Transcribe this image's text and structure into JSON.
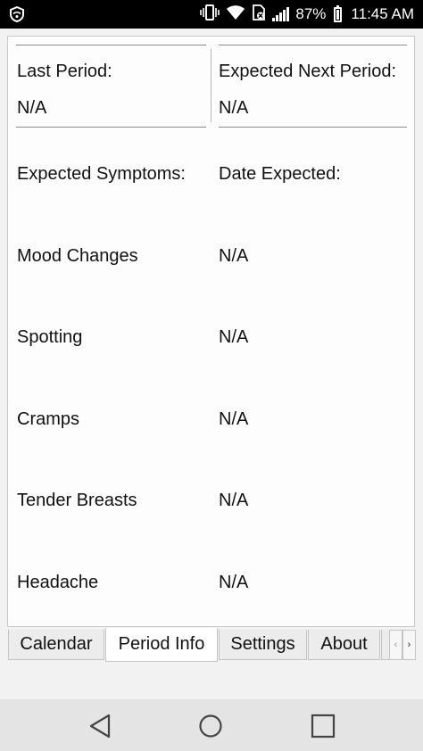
{
  "status_bar": {
    "battery_percent": "87%",
    "time": "11:45 AM",
    "icons": [
      "vpn-shield-icon",
      "vibrate-icon",
      "wifi-icon",
      "no-sim-icon",
      "signal-icon",
      "battery-icon"
    ]
  },
  "period": {
    "last_label": "Last Period:",
    "last_value": "N/A",
    "next_label": "Expected Next Period:",
    "next_value": "N/A"
  },
  "symptoms": {
    "header_symptom": "Expected Symptoms:",
    "header_date": "Date Expected:",
    "items": [
      {
        "name": "Mood Changes",
        "date": "N/A"
      },
      {
        "name": "Spotting",
        "date": "N/A"
      },
      {
        "name": "Cramps",
        "date": "N/A"
      },
      {
        "name": "Tender Breasts",
        "date": "N/A"
      },
      {
        "name": "Headache",
        "date": "N/A"
      }
    ]
  },
  "tabs": [
    {
      "label": "Calendar",
      "active": false
    },
    {
      "label": "Period Info",
      "active": true
    },
    {
      "label": "Settings",
      "active": false
    },
    {
      "label": "About",
      "active": false
    }
  ],
  "tab_scroll": {
    "left": "‹",
    "right": "›"
  },
  "nav": {
    "icons": [
      "back-icon",
      "home-icon",
      "recents-icon"
    ]
  }
}
